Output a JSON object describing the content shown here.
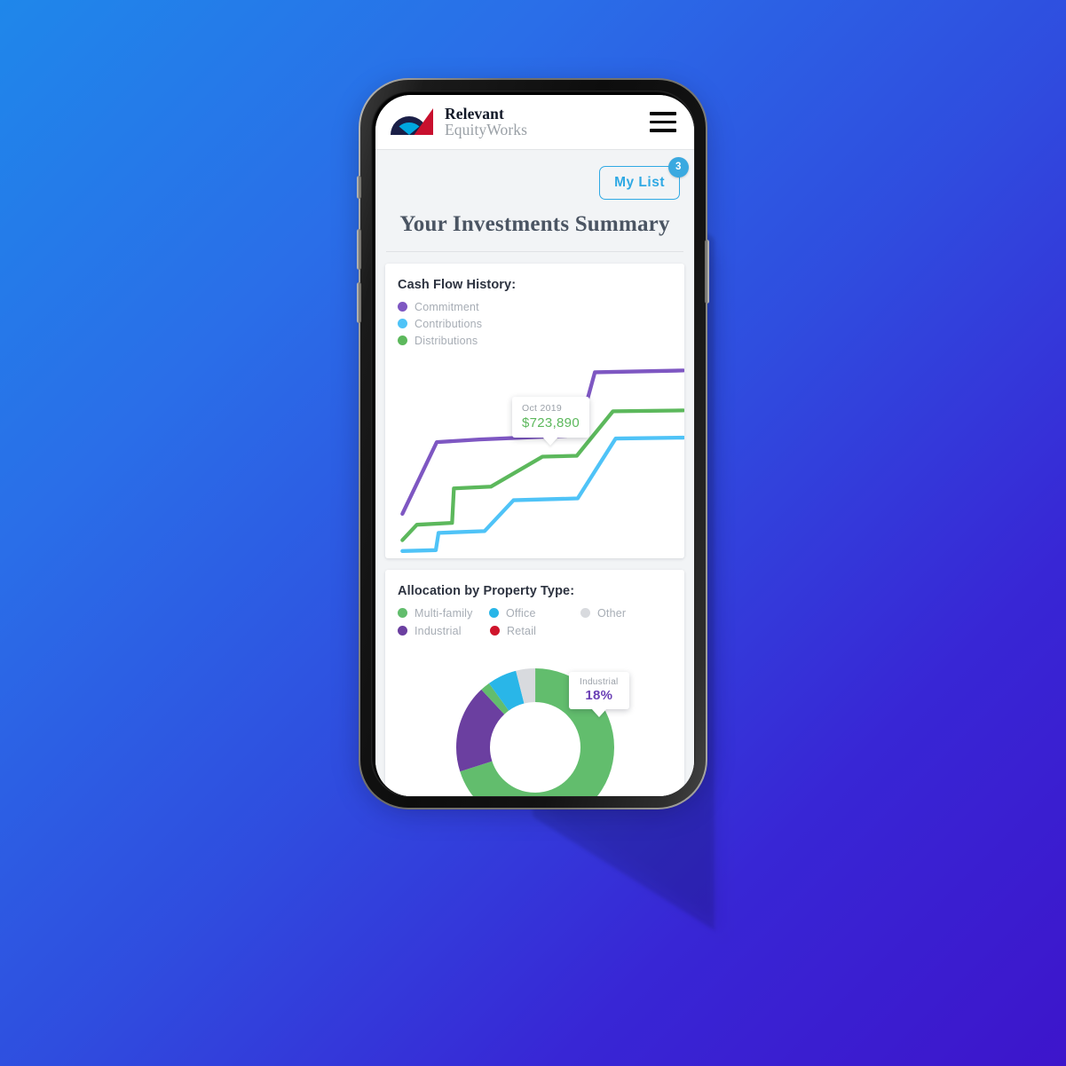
{
  "background": {
    "gradient_from": "#1f87ea",
    "gradient_to": "#3d15cb"
  },
  "app": {
    "logo": {
      "line1": "Relevant",
      "line2": "EquityWorks",
      "colors": {
        "navy": "#1b1f47",
        "cyan": "#00a7e0",
        "crimson": "#c8102e"
      }
    },
    "menu_icon": "hamburger-icon"
  },
  "toolbar": {
    "my_list_label": "My List",
    "my_list_badge": "3",
    "accent": "#2fa9e4"
  },
  "page": {
    "title": "Your Investments Summary"
  },
  "cashflow": {
    "title": "Cash Flow History:",
    "legend": [
      {
        "label": "Commitment",
        "color": "#7e57c2"
      },
      {
        "label": "Contributions",
        "color": "#4fc3f7"
      },
      {
        "label": "Distributions",
        "color": "#5cb85c"
      }
    ],
    "tooltip": {
      "label": "Oct 2019",
      "value": "$723,890",
      "color": "#5cb85c"
    }
  },
  "allocation": {
    "title": "Allocation by Property Type:",
    "legend": [
      {
        "label": "Multi-family",
        "color": "#62bd6d"
      },
      {
        "label": "Office",
        "color": "#29b6e8"
      },
      {
        "label": "Other",
        "color": "#d8dade"
      },
      {
        "label": "Industrial",
        "color": "#6b3fa0"
      },
      {
        "label": "Retail",
        "color": "#cf142b"
      }
    ],
    "tooltip": {
      "label": "Industrial",
      "value": "18%",
      "color": "#6a3fb5"
    }
  },
  "chart_data": [
    {
      "type": "line",
      "title": "Cash Flow History:",
      "xlabel": "",
      "ylabel": "",
      "grid": false,
      "legend_position": "top-left",
      "x": [
        "2016",
        "2016.5",
        "2017",
        "2017.5",
        "2018",
        "2018.5",
        "2019",
        "2019.5",
        "2020",
        "2020.5"
      ],
      "series": [
        {
          "name": "Commitment",
          "color": "#7e57c2",
          "values": [
            28,
            52,
            58,
            58,
            58,
            74,
            86,
            90,
            90,
            90
          ]
        },
        {
          "name": "Distributions",
          "color": "#5cb85c",
          "values": [
            10,
            22,
            24,
            38,
            40,
            52,
            58,
            60,
            78,
            82
          ]
        },
        {
          "name": "Contributions",
          "color": "#4fc3f7",
          "values": [
            2,
            2,
            12,
            14,
            14,
            30,
            32,
            32,
            56,
            60
          ]
        }
      ],
      "ylim": [
        0,
        100
      ],
      "annotation": {
        "label": "Oct 2019",
        "value": "$723,890",
        "series": "Distributions"
      }
    },
    {
      "type": "pie",
      "title": "Allocation by Property Type:",
      "donut": true,
      "legend_position": "top",
      "categories": [
        "Multi-family",
        "Industrial",
        "Retail",
        "Office",
        "Other"
      ],
      "values": [
        70,
        18,
        2,
        6,
        4
      ],
      "colors": [
        "#62bd6d",
        "#6b3fa0",
        "#cf142b",
        "#29b6e8",
        "#d8dade"
      ],
      "annotation": {
        "label": "Industrial",
        "value": "18%"
      }
    }
  ]
}
